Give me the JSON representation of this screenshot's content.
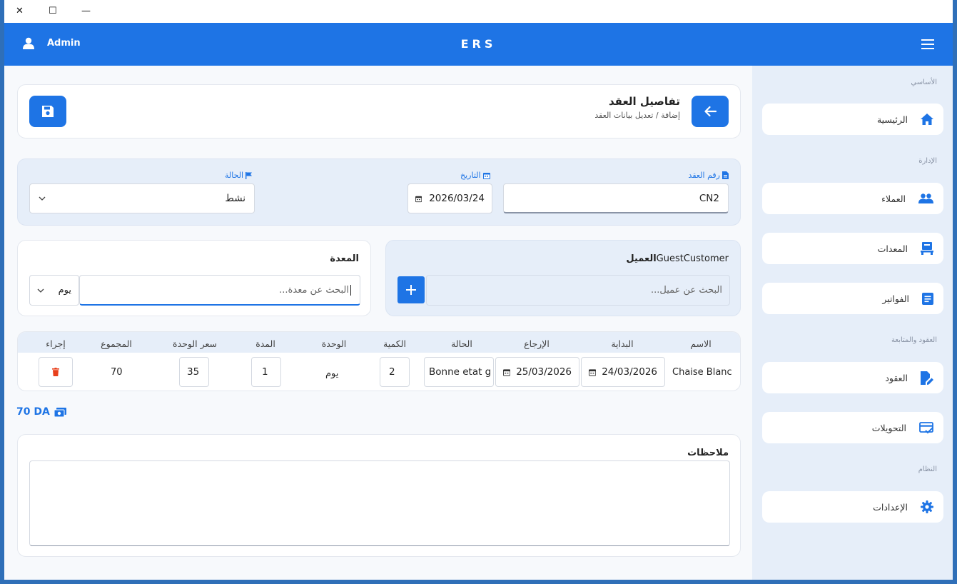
{
  "window": {
    "controls": {
      "close": "✕",
      "maximize": "☐",
      "minimize": "—"
    }
  },
  "header": {
    "user": "Admin",
    "app_title": "ERS"
  },
  "page": {
    "title": "تفاصيل العقد",
    "subtitle": "إضافة / تعديل بيانات العقد"
  },
  "contract": {
    "number_label": "رقم العقد",
    "number_value": "CN2",
    "date_label": "التاريخ",
    "date_value": "2026/03/24",
    "status_label": "الحالة",
    "status_value": "نشط"
  },
  "customer": {
    "label": "العميل",
    "value": "GuestCustomer",
    "search_placeholder": "البحث عن عميل..."
  },
  "equipment": {
    "label": "المعدة",
    "search_placeholder": "البحث عن معدة...",
    "unit_select": "يوم"
  },
  "table": {
    "headers": {
      "name": "الاسم",
      "start": "البداية",
      "return": "الإرجاع",
      "status": "الحالة",
      "quantity": "الكمية",
      "unit": "الوحدة",
      "duration": "المدة",
      "unit_price": "سعر الوحدة",
      "total": "المجموع",
      "action": "إجراء"
    },
    "rows": [
      {
        "name": "Chaise Blanc",
        "start": "24/03/2026",
        "return": "25/03/2026",
        "status": "Bonne etat g",
        "quantity": "2",
        "unit": "يوم",
        "duration": "1",
        "unit_price": "35",
        "total": "70"
      }
    ]
  },
  "total": {
    "value": "70 DA"
  },
  "notes": {
    "label": "ملاحظات",
    "value": ""
  },
  "sidebar": {
    "sections": {
      "basic": "الأساسي",
      "management": "الإدارة",
      "contracts": "العقود والمتابعة",
      "system": "النظام"
    },
    "items": {
      "home": "الرئيسية",
      "customers": "العملاء",
      "equipment": "المعدات",
      "invoices": "الفواتير",
      "contracts": "العقود",
      "transfers": "التحويلات",
      "settings": "الإعدادات"
    }
  },
  "colors": {
    "accent": "#1e74e5",
    "danger": "#e8401c",
    "panel": "#e6eef9"
  }
}
